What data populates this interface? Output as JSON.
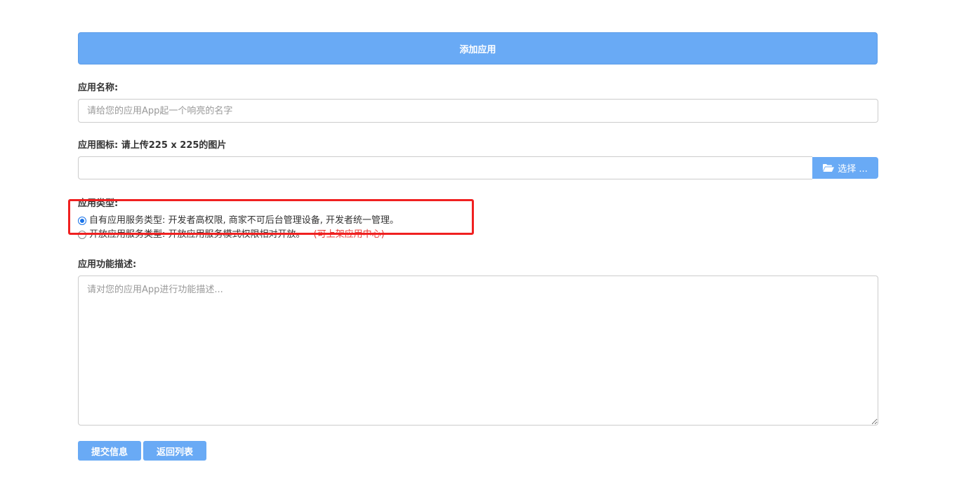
{
  "header": {
    "title": "添加应用"
  },
  "form": {
    "app_name": {
      "label": "应用名称:",
      "placeholder": "请给您的应用App起一个响亮的名字",
      "value": ""
    },
    "app_icon": {
      "label": "应用图标: 请上传225 x 225的图片",
      "select_label": "选择 ...",
      "icon": "folder-open-icon"
    },
    "app_type": {
      "label": "应用类型:",
      "options": [
        {
          "label": "自有应用服务类型: 开发者高权限, 商家不可后台管理设备, 开发者统一管理。",
          "note": "",
          "checked": true
        },
        {
          "label": "开放应用服务类型: 开放应用服务模式权限相对开放。",
          "note": "(可上架应用中心)",
          "checked": false
        }
      ]
    },
    "app_desc": {
      "label": "应用功能描述:",
      "placeholder": "请对您的应用App进行功能描述...",
      "value": ""
    }
  },
  "actions": {
    "submit_label": "提交信息",
    "back_label": "返回列表"
  },
  "colors": {
    "primary": "#69aaf5",
    "highlight": "#f02020",
    "note": "#e53935"
  }
}
